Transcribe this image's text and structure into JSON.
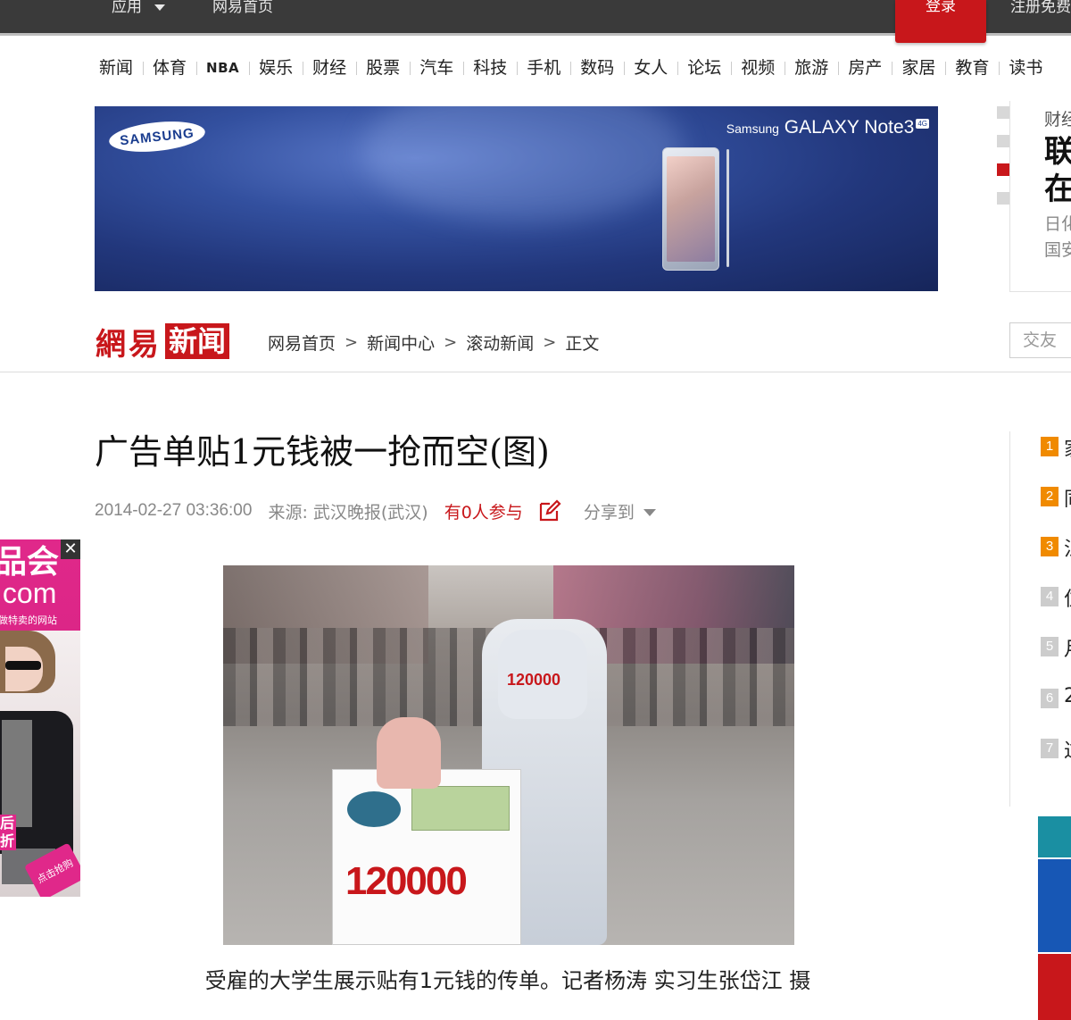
{
  "topbar": {
    "apps_label": "应用",
    "home_label": "网易首页",
    "login_label": "登录",
    "register_label": "注册免费"
  },
  "channels": [
    "新闻",
    "体育",
    "NBA",
    "娱乐",
    "财经",
    "股票",
    "汽车",
    "科技",
    "手机",
    "数码",
    "女人",
    "论坛",
    "视频",
    "旅游",
    "房产",
    "家居",
    "教育",
    "读书"
  ],
  "banner": {
    "logo_text": "SAMSUNG",
    "brand_text": "Samsung",
    "product_text": "GALAXY Note3",
    "badge_text": "4G"
  },
  "right_panel": {
    "category": "财经",
    "headline": "联\n在",
    "subtext": "日化\n国安"
  },
  "logo": {
    "wy": "網易",
    "xw": "新闻"
  },
  "breadcrumb": [
    "网易首页",
    "新闻中心",
    "滚动新闻",
    "正文"
  ],
  "search": {
    "placeholder": "交友"
  },
  "article": {
    "title": "广告单贴1元钱被一抢而空(图)",
    "date": "2014-02-27 03:36:00",
    "source": "来源: 武汉晚报(武汉)",
    "comments": "有0人参与",
    "share_label": "分享到",
    "caption": "受雇的大学生展示贴有1元钱的传单。记者杨涛 实习生张岱江 摄"
  },
  "photo_text": {
    "costume_number": "120000",
    "flyer_number": "120000"
  },
  "float_ad": {
    "line1": "品会",
    "line2": ".com",
    "line3": "做特卖的网站",
    "side": "后\n折",
    "promo": "点击抢购",
    "close": "✕"
  },
  "rank": [
    {
      "num": "1",
      "text": "家"
    },
    {
      "num": "2",
      "text": "同"
    },
    {
      "num": "3",
      "text": "江"
    },
    {
      "num": "4",
      "text": "住"
    },
    {
      "num": "5",
      "text": "月"
    },
    {
      "num": "6",
      "text": "2"
    },
    {
      "num": "7",
      "text": "过"
    }
  ]
}
